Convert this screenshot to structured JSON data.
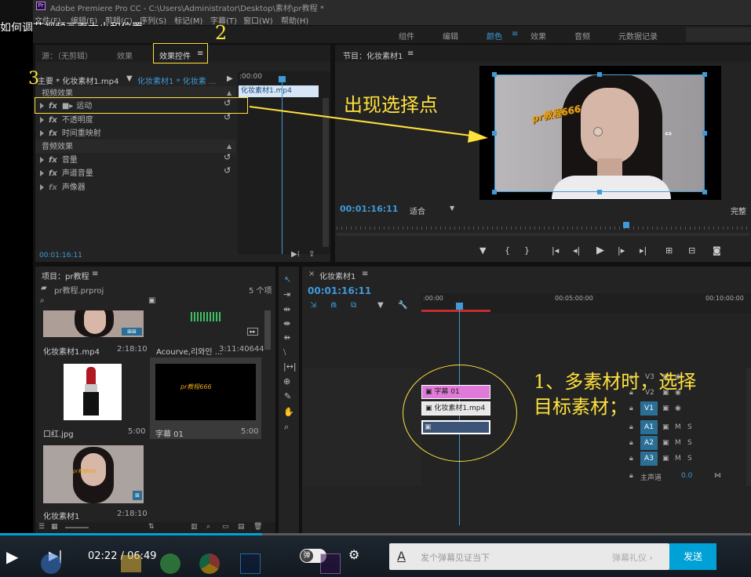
{
  "video_title": "如何调节视频画面大小和位置",
  "window": {
    "title": "Adobe Premiere Pro CC - C:\\Users\\Administrator\\Desktop\\素材\\pr教程 *"
  },
  "menu": [
    "文件(F)",
    "编辑(E)",
    "剪辑(C)",
    "序列(S)",
    "标记(M)",
    "字幕(T)",
    "窗口(W)",
    "帮助(H)"
  ],
  "workspaces": [
    "组件",
    "编辑",
    "颜色",
    "效果",
    "音频",
    "元数据记录"
  ],
  "workspace_menu_glyph": "≡",
  "source_panel": {
    "tabs": [
      "源：（无剪辑）",
      "效果",
      "效果控件"
    ],
    "tab_menu_glyph": "≡",
    "master_label": "主要 * 化妆素材1.mp4",
    "sequence_label": "化妆素材1 * 化妆素 ...",
    "ruler_time": ":00:00",
    "clip_label": "化妆素材1.mp4",
    "video_effects_header": "视频效果",
    "video_effects": [
      "运动",
      "不透明度",
      "时间重映射"
    ],
    "audio_effects_header": "音频效果",
    "audio_effects": [
      "音量",
      "声道音量",
      "声像器"
    ],
    "fx_label": "fx",
    "reset_glyph": "↺",
    "timecode": "00:01:16:11"
  },
  "program": {
    "title": "节目：化妆素材1",
    "timecode": "00:01:16:11",
    "fit": "适合",
    "quality": "完整",
    "overlay_text": "pr教程666"
  },
  "project": {
    "title": "项目：pr教程",
    "file": "pr教程.prproj",
    "count": "5 个项",
    "items": [
      {
        "name": "化妆素材1.mp4",
        "duration": "2:18:10"
      },
      {
        "name": "Acourve,리와인 ...",
        "duration": "3:11:40644"
      },
      {
        "name": "口红.jpg",
        "duration": "5:00"
      },
      {
        "name": "字幕 01",
        "duration": "5:00"
      },
      {
        "name": "化妆素材1",
        "duration": "2:18:10"
      }
    ],
    "thumb_caption": "pr教程666"
  },
  "timeline": {
    "title": "化妆素材1",
    "timecode": "00:01:16:11",
    "ruler": [
      ":00:00",
      "00:05:00:00",
      "00:10:00:00"
    ],
    "tracks": [
      "V3",
      "V2",
      "V1",
      "A1",
      "A2",
      "A3"
    ],
    "master": "主声道",
    "master_value": "0.0",
    "track_btn_m": "M",
    "track_btn_s": "S",
    "clips": {
      "v2": "字幕 01",
      "v1": "化妆素材1.mp4"
    }
  },
  "annotations": {
    "num2": "2",
    "num3": "3",
    "callout1": "出现选择点",
    "callout2_line1": "1、多素材时，选择",
    "callout2_line2": "目标素材；"
  },
  "player": {
    "time": "02:22 / 06:49",
    "danmu_toggle": "弹",
    "danmu_placeholder": "发个弹幕见证当下",
    "danmu_etiquette": "弹幕礼仪 ›",
    "send": "发送",
    "progress": 0.349
  },
  "colors": {
    "accent": "#3f9ad8",
    "annotation": "#ffe13d",
    "v2clip": "#e07ad8",
    "send": "#00a1d6"
  }
}
